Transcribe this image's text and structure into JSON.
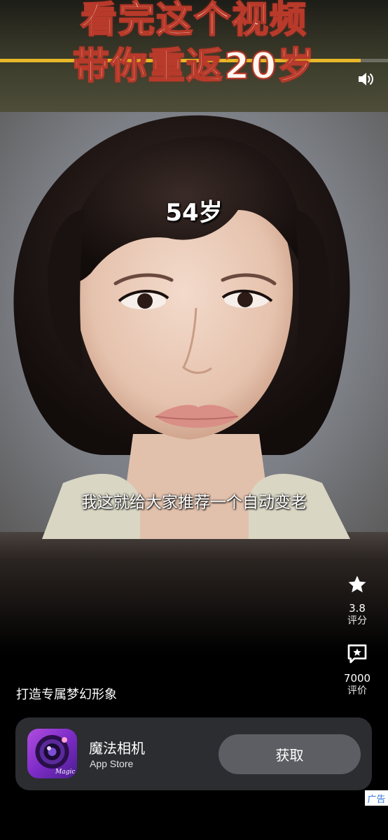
{
  "video": {
    "title_line_1": "看完这个视频",
    "title_line_2": "带你重返20岁",
    "age_label": "54岁",
    "subtitle": "我这就给大家推荐一个自动变老",
    "progress": 0.93,
    "volume_icon": "speaker-icon"
  },
  "rail": {
    "rating_value": "3.8",
    "rating_label": "评分",
    "rating_icon": "star-icon",
    "review_count": "7000",
    "review_label": "评价",
    "review_icon": "star-message-icon"
  },
  "caption": "打造专属梦幻形象",
  "app": {
    "name": "魔法相机",
    "store": "App Store",
    "get_label": "获取",
    "icon_text": "Magic",
    "icon": "camera-lens-icon"
  },
  "ad_label": "广告"
}
